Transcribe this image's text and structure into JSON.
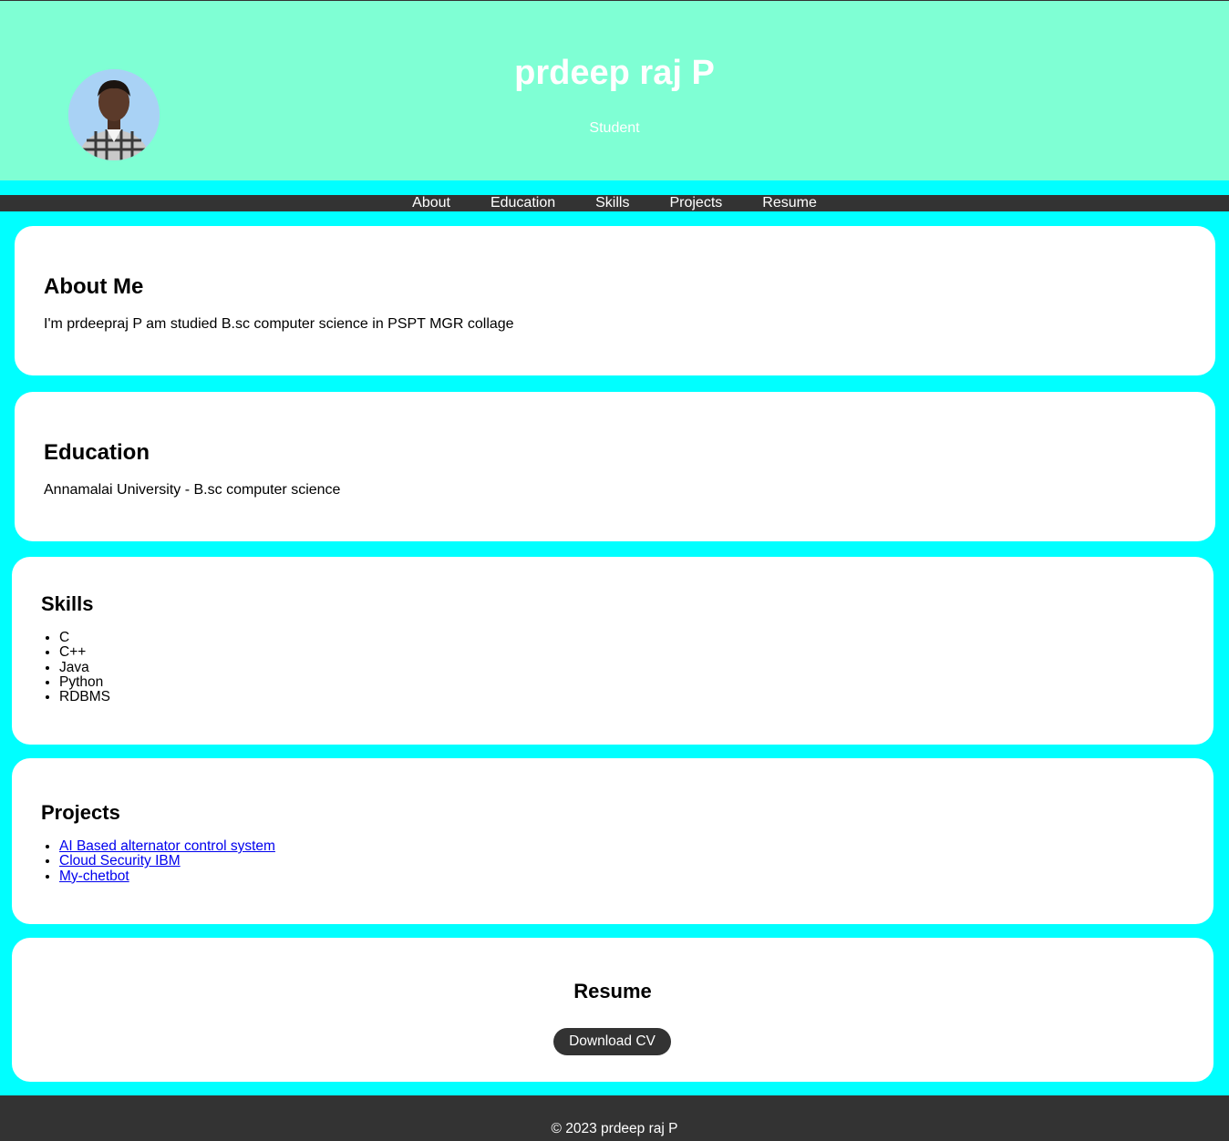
{
  "header": {
    "name": "prdeep raj P",
    "role": "Student"
  },
  "nav": {
    "items": [
      "About",
      "Education",
      "Skills",
      "Projects",
      "Resume"
    ]
  },
  "about": {
    "heading": "About Me",
    "text": "I'm prdeepraj P am studied B.sc computer science in PSPT MGR collage"
  },
  "education": {
    "heading": "Education",
    "text": "Annamalai University - B.sc computer science"
  },
  "skills": {
    "heading": "Skills",
    "items": [
      "C",
      "C++",
      "Java",
      "Python",
      "RDBMS"
    ]
  },
  "projects": {
    "heading": "Projects",
    "items": [
      "AI Based alternator control system",
      "Cloud Security IBM",
      "My-chetbot"
    ]
  },
  "resume": {
    "heading": "Resume",
    "button": "Download CV"
  },
  "footer": {
    "text": "© 2023 prdeep raj P"
  },
  "colors": {
    "page_background": "#00ffff",
    "header_background": "#7fffd4",
    "nav_background": "#333333",
    "link": "#0000ee"
  }
}
